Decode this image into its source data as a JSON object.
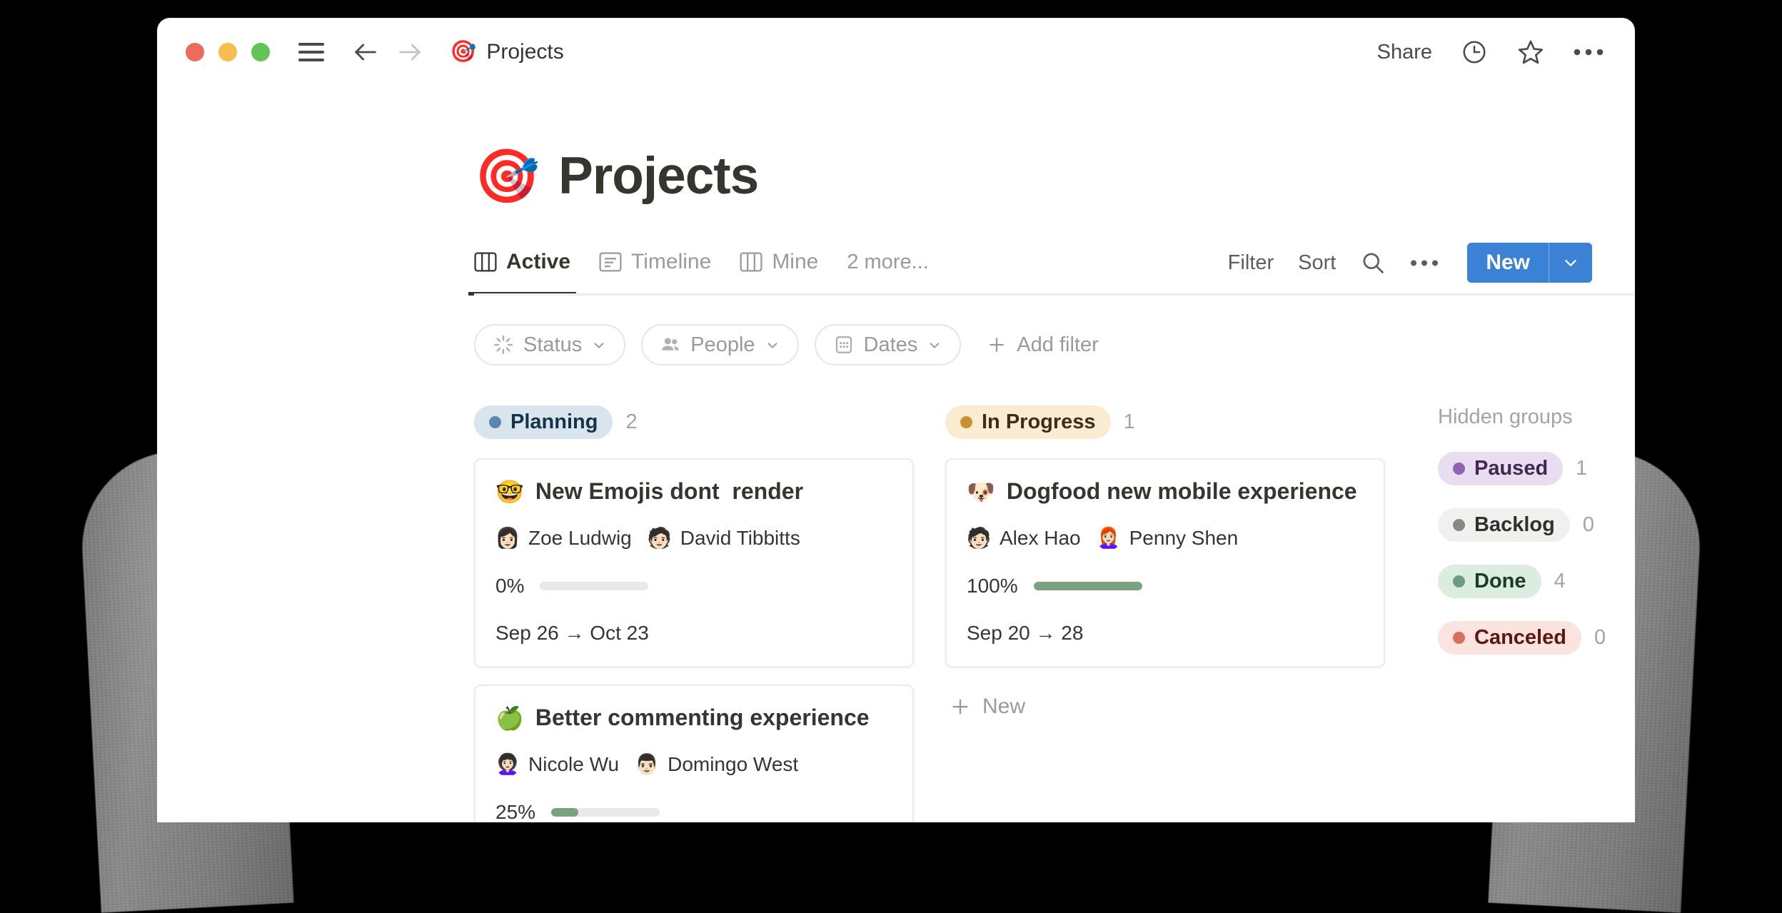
{
  "titlebar": {
    "breadcrumb_emoji": "🎯",
    "breadcrumb_title": "Projects",
    "share_label": "Share",
    "icons": {
      "menu": "hamburger-icon",
      "back": "back-arrow-icon",
      "forward": "forward-arrow-icon",
      "history": "clock-icon",
      "favorite": "star-icon",
      "more": "more-horizontal-icon"
    }
  },
  "page": {
    "emoji": "🎯",
    "title": "Projects"
  },
  "views": {
    "tabs": [
      {
        "label": "Active",
        "icon": "board-view-icon",
        "active": true
      },
      {
        "label": "Timeline",
        "icon": "timeline-view-icon",
        "active": false
      },
      {
        "label": "Mine",
        "icon": "board-view-icon",
        "active": false
      }
    ],
    "more_label": "2 more...",
    "actions": {
      "filter_label": "Filter",
      "sort_label": "Sort",
      "search_icon": "search-icon",
      "more_icon": "more-horizontal-icon",
      "new_label": "New",
      "new_caret_icon": "chevron-down-icon",
      "new_color": "#3b82d6"
    }
  },
  "filters": {
    "chips": [
      {
        "label": "Status",
        "icon": "status-spinner-icon"
      },
      {
        "label": "People",
        "icon": "people-icon"
      },
      {
        "label": "Dates",
        "icon": "calendar-icon"
      }
    ],
    "add_filter_label": "Add filter"
  },
  "board": {
    "groups": [
      {
        "name": "Planning",
        "count": "2",
        "pill_bg": "#d8e5ee",
        "pill_text": "#183347",
        "dot_color": "#5a87ad",
        "cards": [
          {
            "emoji": "🤓",
            "title": "New Emojis dont  render",
            "people": [
              {
                "name": "Zoe Ludwig",
                "avatar": "👩🏻"
              },
              {
                "name": "David Tibbitts",
                "avatar": "🧑🏻"
              }
            ],
            "progress_label": "0%",
            "progress_value": 0,
            "dates": "Sep 26 → Oct 23"
          },
          {
            "emoji": "🍏",
            "title": "Better commenting experience",
            "people": [
              {
                "name": "Nicole Wu",
                "avatar": "👩🏻‍🦱"
              },
              {
                "name": "Domingo West",
                "avatar": "👨🏻"
              }
            ],
            "progress_label": "25%",
            "progress_value": 25,
            "dates": ""
          }
        ],
        "new_label": ""
      },
      {
        "name": "In Progress",
        "count": "1",
        "pill_bg": "#faecd2",
        "pill_text": "#402c1b",
        "dot_color": "#cb912f",
        "cards": [
          {
            "emoji": "🐶",
            "title": "Dogfood new mobile experience",
            "people": [
              {
                "name": "Alex Hao",
                "avatar": "🧑🏻"
              },
              {
                "name": "Penny Shen",
                "avatar": "👩🏻‍🦰"
              }
            ],
            "progress_label": "100%",
            "progress_value": 100,
            "dates": "Sep 20 → 28"
          }
        ],
        "new_label": "New"
      }
    ]
  },
  "hidden_groups": {
    "title": "Hidden groups",
    "items": [
      {
        "label": "Paused",
        "count": "1",
        "pill_bg": "#e9ddf2",
        "pill_text": "#42284f",
        "dot_color": "#9065b0"
      },
      {
        "label": "Backlog",
        "count": "0",
        "pill_bg": "#f0f0ef",
        "pill_text": "#32302c",
        "dot_color": "#8a8884"
      },
      {
        "label": "Done",
        "count": "4",
        "pill_bg": "#dbedde",
        "pill_text": "#1c3829",
        "dot_color": "#6c9b7d"
      },
      {
        "label": "Canceled",
        "count": "0",
        "pill_bg": "#fbe4e0",
        "pill_text": "#5d1715",
        "dot_color": "#d9705f"
      }
    ]
  },
  "progress_color": "#78a37c"
}
